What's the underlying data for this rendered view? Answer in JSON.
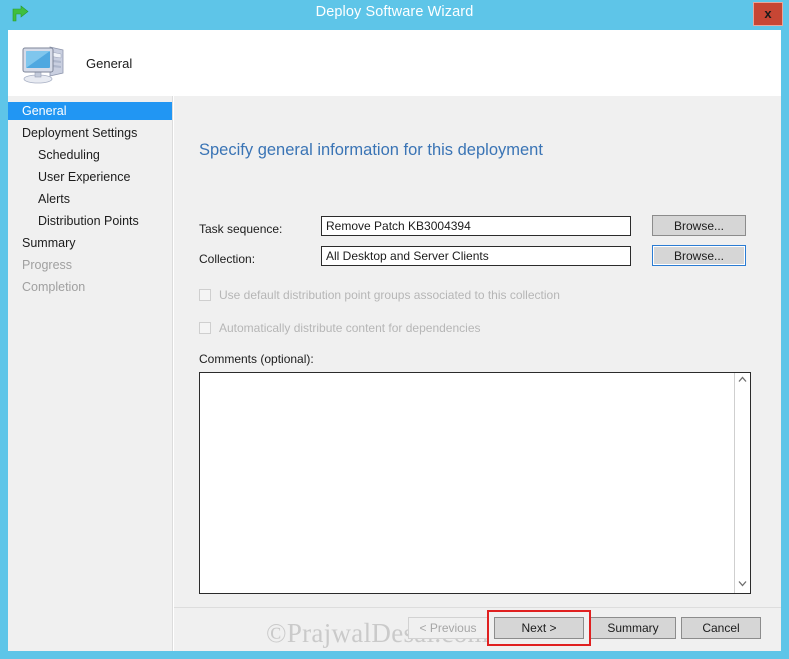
{
  "window": {
    "title": "Deploy Software Wizard",
    "app_icon": "green-arrow-icon",
    "close_label": "x",
    "accent_color": "#5ec5e8",
    "close_color": "#c74634"
  },
  "banner": {
    "icon": "computer-monitor-icon",
    "label": "General"
  },
  "sidebar": {
    "items": [
      {
        "label": "General",
        "state": "selected",
        "indent": false
      },
      {
        "label": "Deployment Settings",
        "state": "normal",
        "indent": false
      },
      {
        "label": "Scheduling",
        "state": "normal",
        "indent": true
      },
      {
        "label": "User Experience",
        "state": "normal",
        "indent": true
      },
      {
        "label": "Alerts",
        "state": "normal",
        "indent": true
      },
      {
        "label": "Distribution Points",
        "state": "normal",
        "indent": true
      },
      {
        "label": "Summary",
        "state": "normal",
        "indent": false
      },
      {
        "label": "Progress",
        "state": "disabled",
        "indent": false
      },
      {
        "label": "Completion",
        "state": "disabled",
        "indent": false
      }
    ],
    "selected_color": "#2196f3"
  },
  "main": {
    "heading": "Specify general information for this deployment",
    "heading_color": "#3a74b5",
    "fields": [
      {
        "label": "Task sequence:",
        "value": "Remove Patch KB3004394",
        "button": "Browse...",
        "button_focused": false
      },
      {
        "label": "Collection:",
        "value": "All Desktop and Server Clients",
        "button": "Browse...",
        "button_focused": true
      }
    ],
    "checkboxes": [
      {
        "label": "Use default distribution point groups associated to this collection",
        "checked": false,
        "disabled": true
      },
      {
        "label": "Automatically distribute content for dependencies",
        "checked": false,
        "disabled": true
      }
    ],
    "comments": {
      "label": "Comments (optional):",
      "value": "",
      "placeholder": ""
    },
    "scrollbar": {
      "up_icon": "chevron-up-icon",
      "down_icon": "chevron-down-icon"
    }
  },
  "footer": {
    "buttons": [
      {
        "label": "< Previous",
        "disabled": true,
        "highlighted": false
      },
      {
        "label": "Next >",
        "disabled": false,
        "highlighted": true
      },
      {
        "label": "Summary",
        "disabled": false,
        "highlighted": false
      },
      {
        "label": "Cancel",
        "disabled": false,
        "highlighted": false
      }
    ],
    "annotation_color": "#e02020"
  },
  "watermark": {
    "text": "©PrajwalDesai.com"
  }
}
